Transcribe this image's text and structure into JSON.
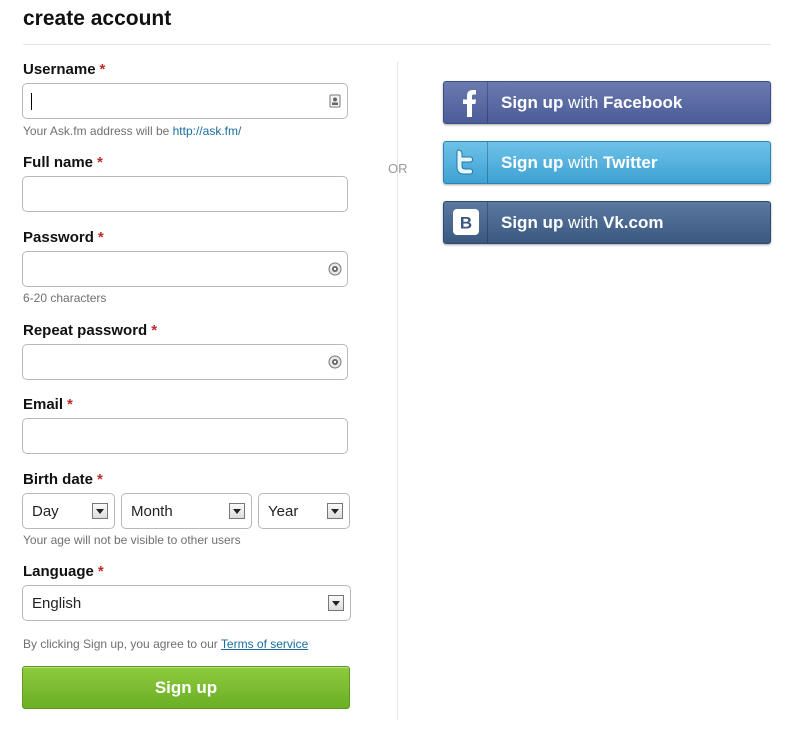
{
  "header": {
    "title": "create account"
  },
  "divider": {
    "or_label": "OR"
  },
  "form": {
    "username": {
      "label": "Username",
      "required": "*",
      "value": "",
      "hint_prefix": "Your Ask.fm address will be ",
      "hint_link": "http://ask.fm/"
    },
    "full_name": {
      "label": "Full name",
      "required": "*",
      "value": ""
    },
    "password": {
      "label": "Password",
      "required": "*",
      "value": "",
      "hint": "6-20 characters"
    },
    "repeat_password": {
      "label": "Repeat password",
      "required": "*",
      "value": ""
    },
    "email": {
      "label": "Email",
      "required": "*",
      "value": ""
    },
    "birth_date": {
      "label": "Birth date",
      "required": "*",
      "day": "Day",
      "month": "Month",
      "year": "Year",
      "hint": "Your age will not be visible to other users"
    },
    "language": {
      "label": "Language",
      "required": "*",
      "value": "English"
    },
    "terms": {
      "prefix": "By clicking Sign up, you agree to our ",
      "link": "Terms of service"
    },
    "submit_label": "Sign up"
  },
  "social": {
    "facebook": {
      "prefix": "Sign up",
      "with": " with ",
      "name": "Facebook",
      "icon": "facebook-icon",
      "color": "#4b5c98"
    },
    "twitter": {
      "prefix": "Sign up",
      "with": " with ",
      "name": "Twitter",
      "icon": "twitter-icon",
      "color": "#3ea1d3"
    },
    "vk": {
      "prefix": "Sign up",
      "with": " with ",
      "name": "Vk.com",
      "icon": "vk-icon",
      "color": "#3b5880"
    }
  },
  "colors": {
    "required": "#c0292a",
    "link": "#1a6d9e",
    "signup_button": "#76b82a"
  }
}
